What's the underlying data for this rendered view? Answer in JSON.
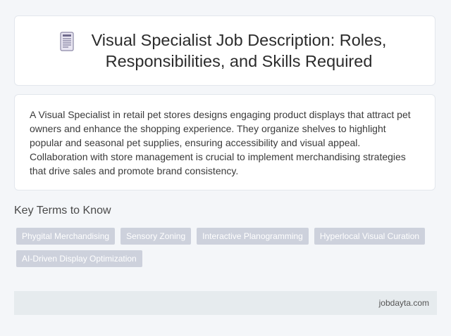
{
  "header": {
    "icon": "document-icon",
    "title": "Visual Specialist Job Description: Roles, Responsibilities, and Skills Required"
  },
  "description": {
    "text": "A Visual Specialist in retail pet stores designs engaging product displays that attract pet owners and enhance the shopping experience. They organize shelves to highlight popular and seasonal pet supplies, ensuring accessibility and visual appeal. Collaboration with store management is crucial to implement merchandising strategies that drive sales and promote brand consistency."
  },
  "key_terms": {
    "heading": "Key Terms to Know",
    "tags": [
      "Phygital Merchandising",
      "Sensory Zoning",
      "Interactive Planogramming",
      "Hyperlocal Visual Curation",
      "AI-Driven Display Optimization"
    ]
  },
  "footer": {
    "site": "jobdayta.com"
  },
  "colors": {
    "background": "#f4f6f9",
    "tag_background": "#cdd1dc",
    "footer_background": "#e6ebee"
  }
}
